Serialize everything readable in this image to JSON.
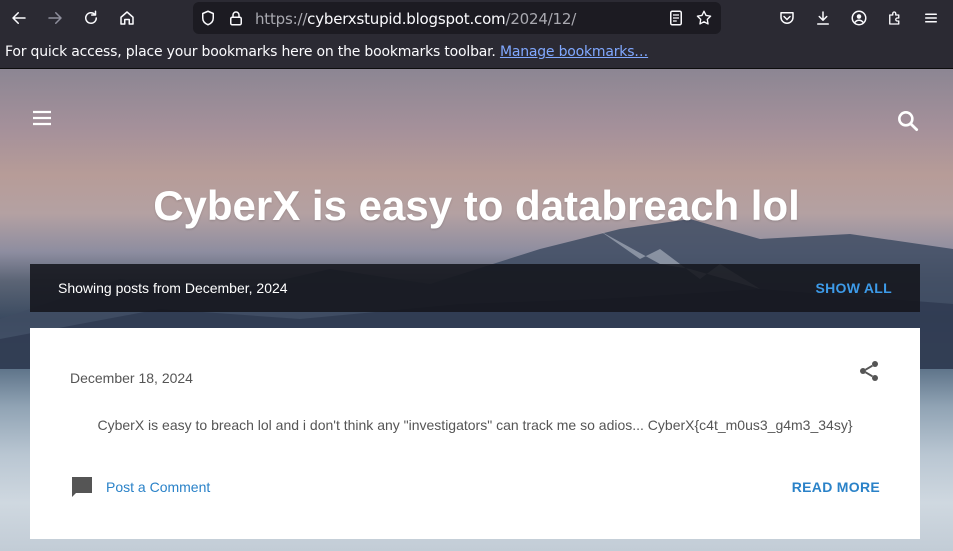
{
  "browser": {
    "url_prefix": "https://",
    "url_host": "cyberxstupid.blogspot.com",
    "url_path": "/2024/12/",
    "bookmarks_message": "For quick access, place your bookmarks here on the bookmarks toolbar.",
    "bookmarks_link": "Manage bookmarks…"
  },
  "blog": {
    "title": "CyberX is easy to databreach lol",
    "filter_text": "Showing posts from December, 2024",
    "show_all_label": "SHOW ALL"
  },
  "post": {
    "date": "December 18, 2024",
    "snippet": "CyberX is easy to breach lol and i don't think any \"investigators\" can track me so adios... CyberX{c4t_m0us3_g4m3_34sy}",
    "comment_label": "Post a Comment",
    "read_more_label": "READ MORE"
  },
  "colors": {
    "accent": "#2a82c8",
    "show_all": "#3d9be9",
    "toolbar": "#2b2a33"
  }
}
